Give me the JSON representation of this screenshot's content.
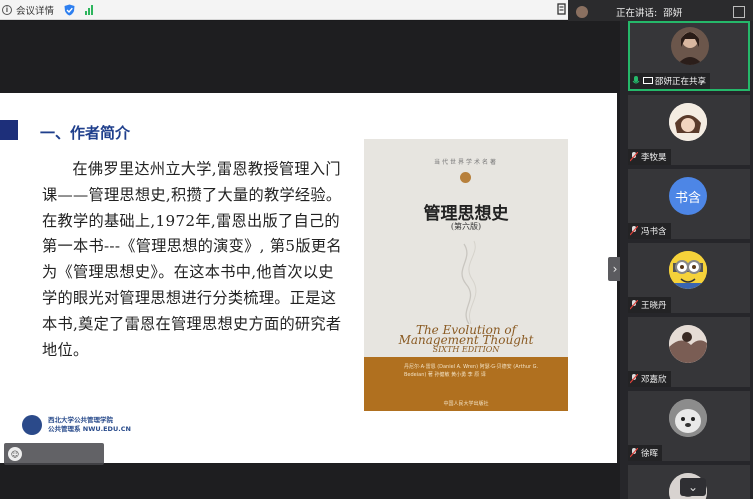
{
  "topbar": {
    "info_label": "会议详情",
    "info_icon": "i",
    "speaking_label": "正在讲话:",
    "speaker_name": "邵妍"
  },
  "slide": {
    "heading": "一、作者简介",
    "paragraph": "在佛罗里达州立大学,雷恩教授管理入门课——管理思想史,积攒了大量的教学经验。在教学的基础上,1972年,雷恩出版了自己的第一本书---《管理思想的演变》, 第5版更名为《管理思想史》。在这本书中,他首次以史学的眼光对管理思想进行分类梳理。正是这本书,奠定了雷恩在管理思想史方面的研究者地位。",
    "book": {
      "series": "当代世界学术名著",
      "title": "管理思想史",
      "edition": "(第六版)",
      "en_title_line1": "The Evolution of",
      "en_title_line2": "Management Thought",
      "en_edition": "SIXTH EDITION",
      "authors": "丹尼尔·A·雷恩 (Daniel A. Wren) 阿瑟·G·贝德安 (Arthur G. Bedeian) 著 孙健敏 黄小勇 李 原 译",
      "publisher": "中国人民大学出版社"
    },
    "watermark_line1": "西北大学公共管理学院",
    "watermark_line2": "公共管理系 NWU.EDU.CN"
  },
  "participants": [
    {
      "name": "邵妍正在共享",
      "active": true,
      "avatar": "photo",
      "mic": "on"
    },
    {
      "name": "李牧昊",
      "active": false,
      "avatar": "cartoon",
      "mic": "muted"
    },
    {
      "name": "冯书含",
      "active": false,
      "avatar": "text",
      "avatar_text": "书含",
      "mic": "muted"
    },
    {
      "name": "王晓丹",
      "active": false,
      "avatar": "minion",
      "mic": "muted"
    },
    {
      "name": "邓嘉欣",
      "active": false,
      "avatar": "photo",
      "mic": "muted"
    },
    {
      "name": "徐晖",
      "active": false,
      "avatar": "dog",
      "mic": "muted"
    },
    {
      "name": "",
      "active": false,
      "avatar": "photo",
      "mic": "muted"
    }
  ],
  "colors": {
    "accent_green": "#25b86a",
    "heading_blue": "#1f3f8c",
    "book_orange": "#b0701f",
    "mute_red": "#e0413a"
  },
  "icons": {
    "expand": "›",
    "chevron_down": "⌄",
    "page_mic": "☺"
  }
}
